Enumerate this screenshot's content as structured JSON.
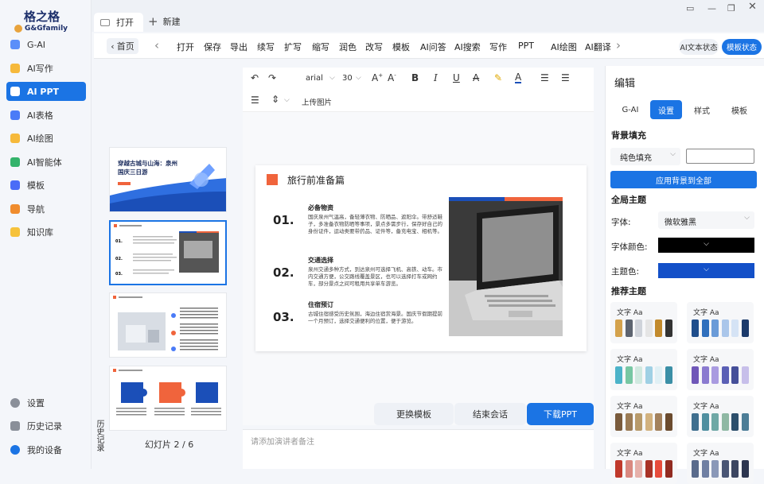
{
  "app": {
    "logo_cn": "格之格",
    "logo_en": "G&Gfamily"
  },
  "sidebar": {
    "items": [
      {
        "label": "G-AI",
        "color": "#5b8ff9"
      },
      {
        "label": "AI写作",
        "color": "#f6b93b"
      },
      {
        "label": "AI PPT",
        "color": "#ffffff"
      },
      {
        "label": "AI表格",
        "color": "#4a7bf7"
      },
      {
        "label": "AI绘图",
        "color": "#f6b93b"
      },
      {
        "label": "AI智能体",
        "color": "#34b36b"
      },
      {
        "label": "模板",
        "color": "#4a6cf7"
      },
      {
        "label": "导航",
        "color": "#f08c2d"
      },
      {
        "label": "知识库",
        "color": "#f6c23b"
      }
    ],
    "bottom": [
      {
        "label": "设置"
      },
      {
        "label": "历史记录"
      },
      {
        "label": "我的设备"
      }
    ]
  },
  "tabs": {
    "open": "打开",
    "new": "新建"
  },
  "toolbar": {
    "home": "首页",
    "items": [
      "打开",
      "保存",
      "导出",
      "续写",
      "扩写",
      "缩写",
      "润色",
      "改写",
      "模板",
      "AI问答",
      "AI搜索",
      "写作",
      "PPT",
      "AI绘图",
      "AI翻译"
    ],
    "pill1": "AI文本状态",
    "pill2": "模板状态"
  },
  "format": {
    "font": "arial",
    "size": "30",
    "upload": "上传图片"
  },
  "thumbs": {
    "t1": "穿越古城与山海：泉州国庆三日游",
    "vtab": "历史记录",
    "count": "幻灯片 2 / 6"
  },
  "slide": {
    "title": "旅行前准备篇",
    "sections": [
      {
        "num": "01.",
        "head": "必备物资",
        "body": "国庆泉州气温高，备轻薄衣物、防晒品、遮阳伞。带舒适鞋子，多准备衣物防晒等事项，景点多需步行，保存好自己的身份证件，运动类要带药品、证件等，备充电宝、相机等。"
      },
      {
        "num": "02.",
        "head": "交通选择",
        "body": "泉州交通多种方式，到达泉州可选择飞机、高铁、动车。市内交通方便，公交路线覆盖景区，也可以选择打车或网约车，部分景点之间可租用共享单车游览。"
      },
      {
        "num": "03.",
        "head": "住宿预订",
        "body": "古城住宿感受历史氛围，海边住宿赏海景。国庆节假期提前一个月预订，选择交通便利的位置，便于游览。"
      }
    ]
  },
  "buttons": {
    "template": "更换模板",
    "end": "结束会话",
    "download": "下载PPT"
  },
  "notes": {
    "placeholder": "请添加演讲者备注"
  },
  "right": {
    "title": "编辑",
    "tabs": [
      "G-AI",
      "设置",
      "样式",
      "模板"
    ],
    "bg_section": "背景填充",
    "fill": "纯色填充",
    "apply": "应用背景到全部",
    "global": "全局主题",
    "font_label": "字体:",
    "font_value": "微软雅黑",
    "fontcolor_label": "字体颜色:",
    "theme_label": "主题色:",
    "recommend": "推荐主题",
    "theme_text": "文字 Aa",
    "themes": [
      [
        "#d4a24c",
        "#5d6470",
        "#cfd3da",
        "#e5e5e5",
        "#c28a2c",
        "#333"
      ],
      [
        "#1f4e8c",
        "#2f6fbd",
        "#6a9bd8",
        "#aac6ea",
        "#d5e3f5",
        "#1b3a6b"
      ],
      [
        "#4cb3c9",
        "#77c7a3",
        "#d0e9e0",
        "#9fd0e4",
        "#e0f0f5",
        "#3b8fa6"
      ],
      [
        "#6f57b8",
        "#8a7ad0",
        "#a99be0",
        "#5a5fb5",
        "#454f99",
        "#c7bfea"
      ],
      [
        "#7a5b3c",
        "#9b7b55",
        "#b89a6a",
        "#d2b27f",
        "#a3815c",
        "#6b4b2e"
      ],
      [
        "#3f6f8f",
        "#4f8fa0",
        "#6fa8a6",
        "#8fb8a4",
        "#2d4f6c",
        "#4c7d97"
      ],
      [
        "#c0392b",
        "#d98880",
        "#e6b0aa",
        "#a93226",
        "#e74c3c",
        "#922b21"
      ],
      [
        "#5a6b8c",
        "#6f7fa3",
        "#8a98b8",
        "#4a5675",
        "#3c4661",
        "#2d3650"
      ]
    ]
  }
}
